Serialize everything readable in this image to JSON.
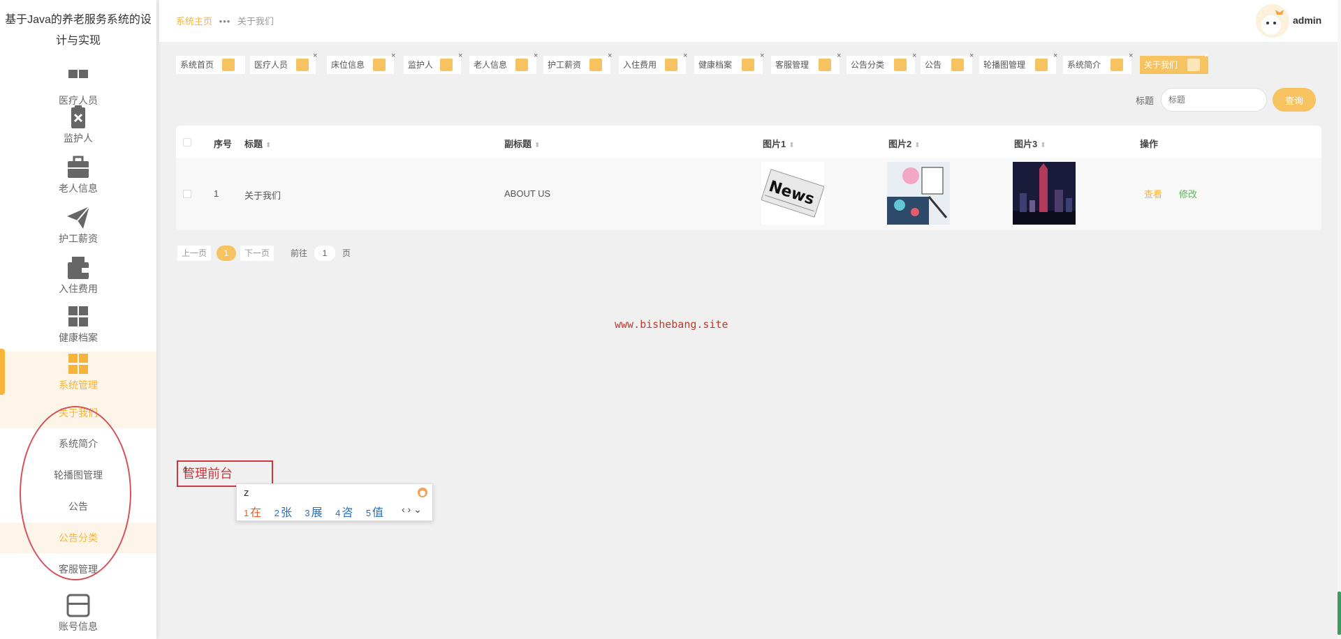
{
  "sidebar": {
    "brand": "基于Java的养老服务系统的设计与实现",
    "menu": [
      {
        "label": "医疗人员",
        "icon": "grid-icon"
      },
      {
        "label": "监护人",
        "icon": "clipboard-x-icon"
      },
      {
        "label": "老人信息",
        "icon": "briefcase-icon"
      },
      {
        "label": "护工薪资",
        "icon": "paper-plane-icon"
      },
      {
        "label": "入住费用",
        "icon": "wallet-icon"
      },
      {
        "label": "健康档案",
        "icon": "grid-icon"
      },
      {
        "label": "系统管理",
        "icon": "grid-icon"
      }
    ],
    "submenu": [
      "关于我们",
      "系统简介",
      "轮播图管理",
      "公告",
      "公告分类",
      "客服管理"
    ],
    "bottom_item": {
      "label": "账号信息",
      "icon": "card-icon"
    }
  },
  "header": {
    "breadcrumb_home": "系统主页",
    "breadcrumb_current": "关于我们",
    "username": "admin"
  },
  "tags": [
    "系统首页",
    "医疗人员",
    "床位信息",
    "监护人",
    "老人信息",
    "护工薪资",
    "入住费用",
    "健康档案",
    "客服管理",
    "公告分类",
    "公告",
    "轮播图管理",
    "系统简介",
    "关于我们"
  ],
  "search": {
    "label": "标题",
    "placeholder": "标题",
    "button": "查询"
  },
  "table": {
    "headers": [
      "序号",
      "标题",
      "副标题",
      "图片1",
      "图片2",
      "图片3",
      "操作"
    ],
    "rows": [
      {
        "index": "1",
        "title": "关于我们",
        "subtitle": "ABOUT US",
        "img1": "news-newspaper-image",
        "img2": "illustration-image",
        "img3": "city-night-image",
        "view": "查看",
        "edit": "修改"
      }
    ]
  },
  "pagination": {
    "prev": "上一页",
    "current": "1",
    "next": "下一页",
    "goto": "前往",
    "page_input": "1",
    "page_unit": "页"
  },
  "watermark": "www.bishebang.site",
  "annotation": "管理前台",
  "ime": {
    "input": "z",
    "candidates": [
      {
        "n": "1",
        "c": "在"
      },
      {
        "n": "2",
        "c": "张"
      },
      {
        "n": "3",
        "c": "展"
      },
      {
        "n": "4",
        "c": "咨"
      },
      {
        "n": "5",
        "c": "值"
      }
    ],
    "nav": "‹ › ⌄"
  },
  "colors": {
    "accent": "#f7b33a",
    "tag_square": "#f7c260",
    "edit": "#5cb85c",
    "annotation": "#c8383e",
    "watermark": "#c0392b"
  }
}
